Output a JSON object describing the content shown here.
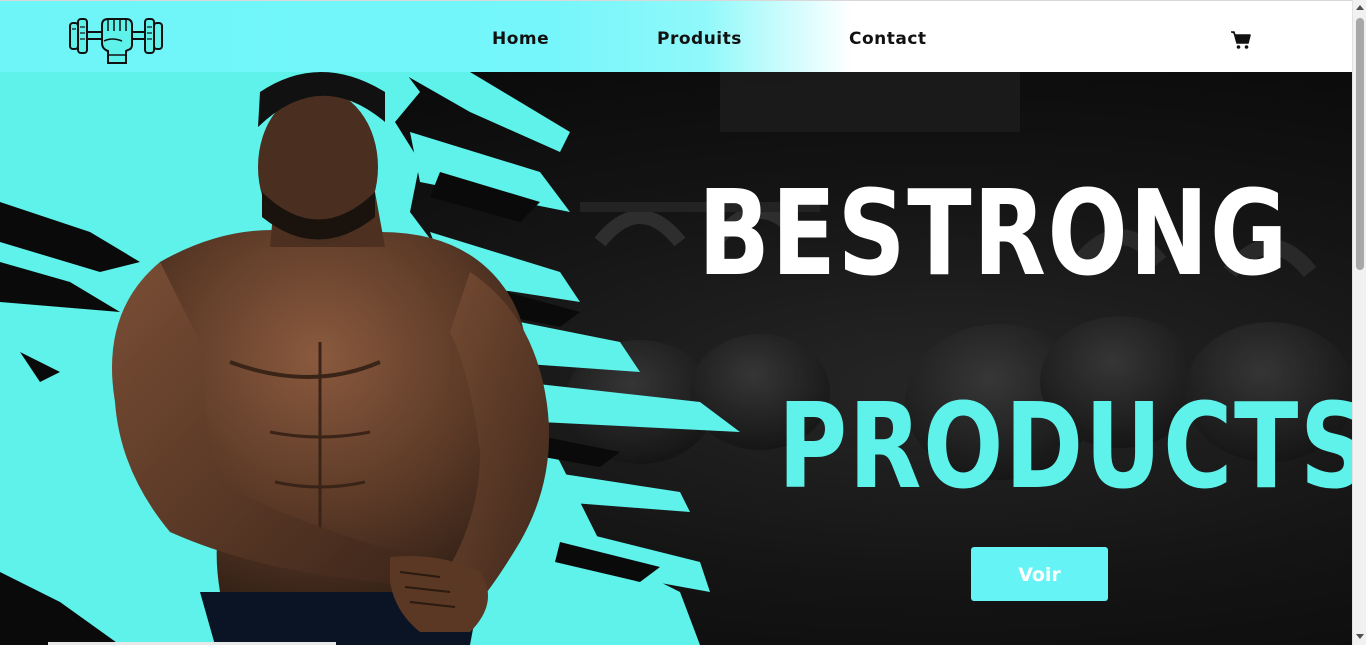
{
  "nav": {
    "logo_icon": "fist-dumbbell-logo-icon",
    "links": [
      {
        "label": "Home"
      },
      {
        "label": "Produits"
      },
      {
        "label": "Contact"
      }
    ],
    "cart_icon": "shopping-cart-icon"
  },
  "hero": {
    "title_line1": "BESTRONG",
    "title_line2": "PRODUCTS",
    "cta_label": "Voir",
    "image": "muscular-man-gym-photo"
  },
  "colors": {
    "accent": "#66f3f5",
    "title_accent": "#5ef2ea",
    "background_dark": "#0a0a0a"
  }
}
